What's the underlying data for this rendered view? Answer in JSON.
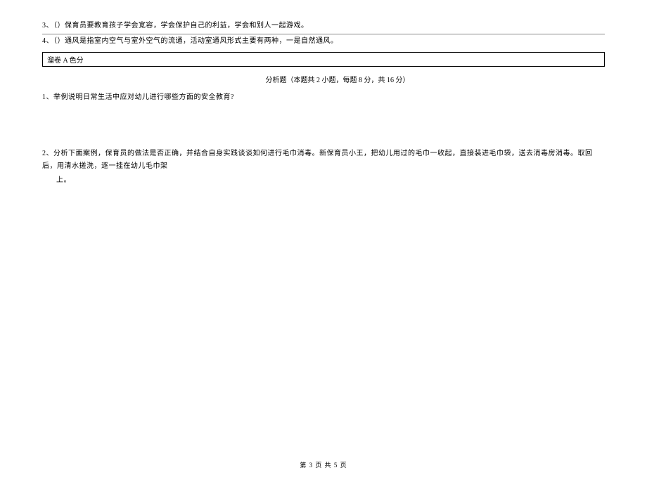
{
  "questions_top": {
    "q3": "3、（）保育员要教育孩子学会宽容，学会保护自己的利益，学会和别人一起游戏。",
    "q4": "4、（）通风是指室内空气与室外空气的流通，活动室通风形式主要有两种，一是自然通风。"
  },
  "section": {
    "header": "溜卷 A 色分",
    "title": "分析题（本题共 2 小题，每题 8 分，共 16 分）"
  },
  "analysis_questions": {
    "q1": "1、举例说明日常生活中应对幼儿进行哪些方面的安全教育?",
    "q2_line1": "2、分析下面案例，保育员的做法是否正确，并结合自身实践谈谈如何进行毛巾消毒。新保育员小王，把幼儿用过的毛巾一收起，直接装进毛巾袋，送去消毒房消毒。取回后，用清水搓洗，逐一挂在幼儿毛巾架",
    "q2_line2": "上。"
  },
  "footer": {
    "page": "第 3 页 共 5 页"
  }
}
